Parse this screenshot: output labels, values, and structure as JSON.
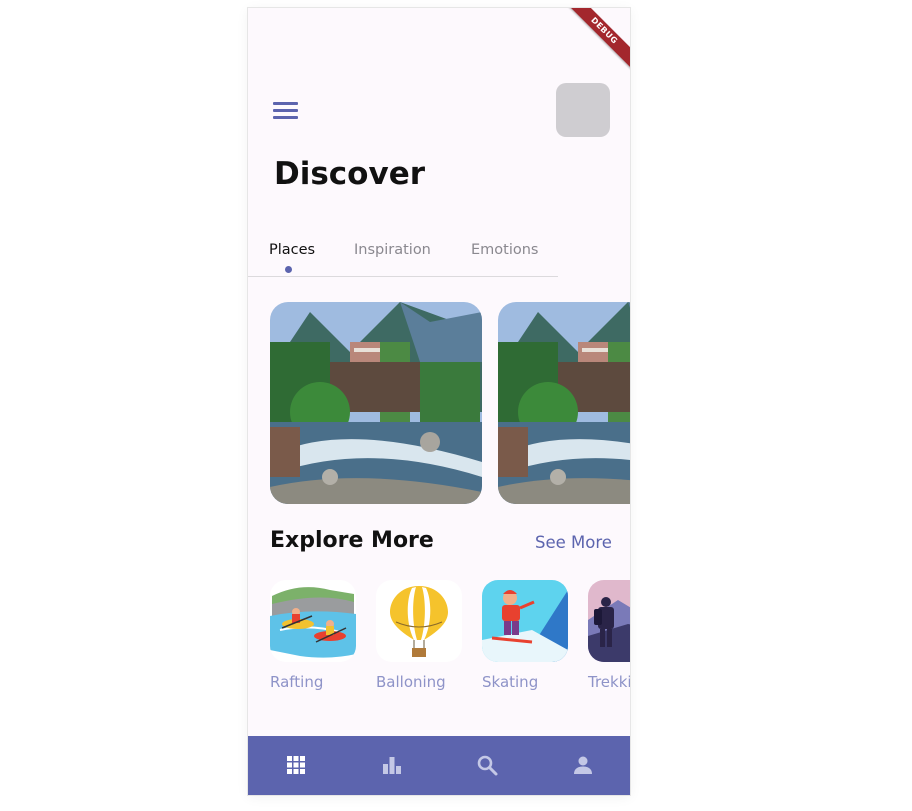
{
  "debug_banner": "DEBUG",
  "header": {
    "menu_icon": "menu-icon",
    "avatar": "profile-avatar"
  },
  "page_title": "Discover",
  "tabs": [
    {
      "label": "Places",
      "active": true
    },
    {
      "label": "Inspiration",
      "active": false
    },
    {
      "label": "Emotions",
      "active": false
    }
  ],
  "places": [
    {
      "image": "mountain-river-village-photo"
    },
    {
      "image": "mountain-river-village-photo"
    }
  ],
  "explore": {
    "title": "Explore More",
    "see_more": "See More",
    "activities": [
      {
        "label": "Rafting",
        "icon": "rafting-illustration"
      },
      {
        "label": "Balloning",
        "icon": "hot-air-balloon-illustration"
      },
      {
        "label": "Skating",
        "icon": "skiing-illustration"
      },
      {
        "label": "Trekki",
        "icon": "trekking-illustration"
      }
    ]
  },
  "bottom_nav": [
    {
      "icon": "grid-icon",
      "active": true
    },
    {
      "icon": "bar-chart-icon",
      "active": false
    },
    {
      "icon": "search-icon",
      "active": false
    },
    {
      "icon": "person-icon",
      "active": false
    }
  ],
  "colors": {
    "accent": "#5c64ae",
    "background": "#fdf9fd",
    "avatar": "#cfcdd1",
    "activity_label": "#8e93c8",
    "debug": "#a3272d"
  }
}
